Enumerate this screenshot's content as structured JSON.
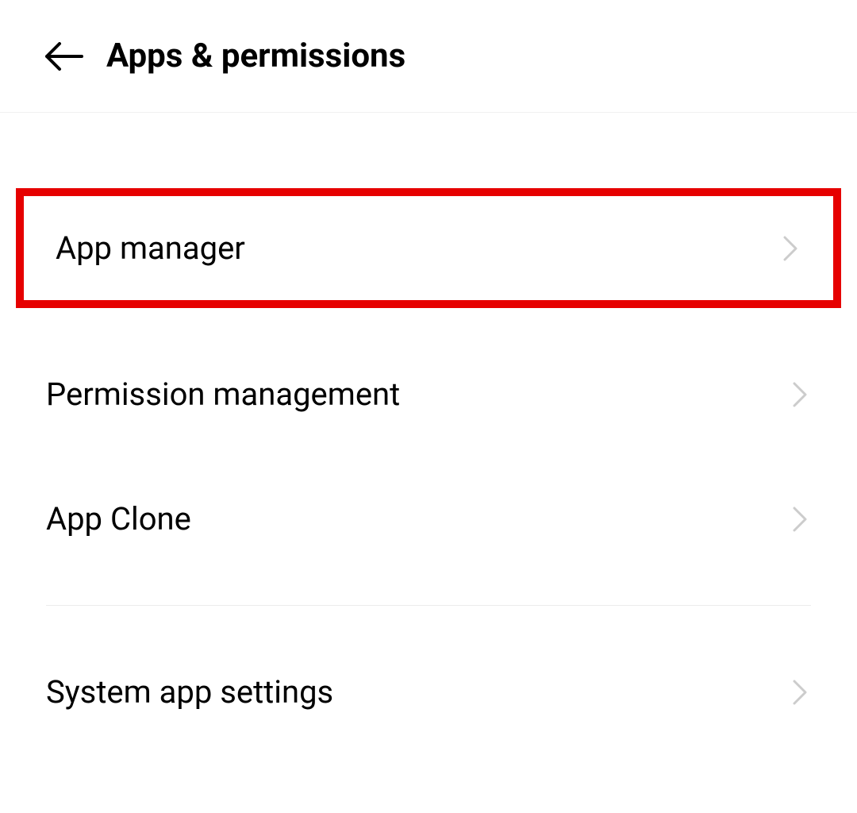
{
  "header": {
    "title": "Apps & permissions"
  },
  "items": [
    {
      "label": "App manager"
    },
    {
      "label": "Permission management"
    },
    {
      "label": "App Clone"
    },
    {
      "label": "System app settings"
    }
  ],
  "highlight_color": "#e60000"
}
